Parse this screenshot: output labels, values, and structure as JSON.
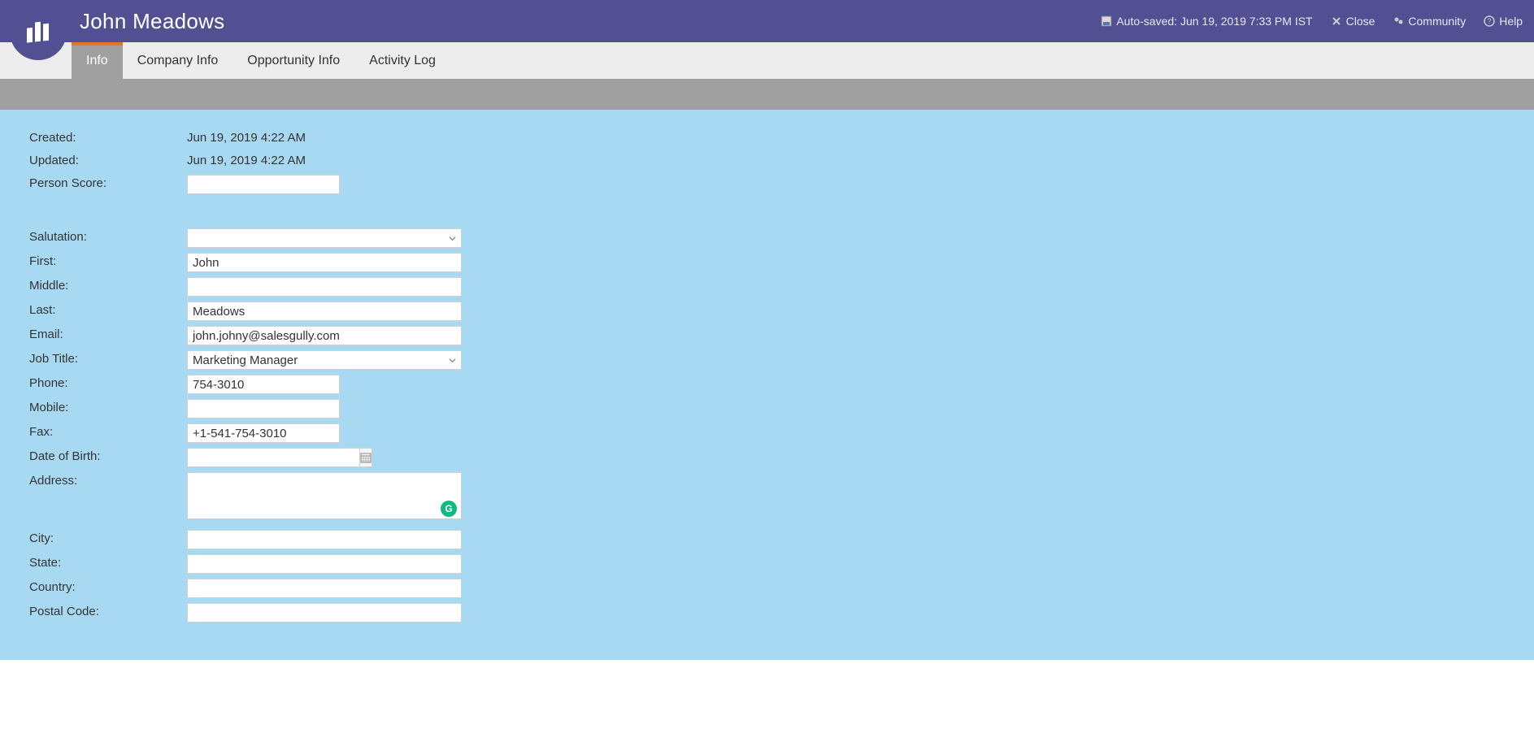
{
  "header": {
    "title": "John Meadows",
    "autosaved_label": "Auto-saved: Jun 19, 2019 7:33 PM IST",
    "close_label": "Close",
    "community_label": "Community",
    "help_label": "Help"
  },
  "tabs": {
    "info": "Info",
    "company": "Company Info",
    "opportunity": "Opportunity Info",
    "activity": "Activity Log"
  },
  "meta": {
    "created_label": "Created:",
    "created_value": "Jun 19, 2019 4:22 AM",
    "updated_label": "Updated:",
    "updated_value": "Jun 19, 2019 4:22 AM",
    "person_score_label": "Person Score:",
    "person_score_value": ""
  },
  "form": {
    "salutation_label": "Salutation:",
    "salutation_value": "",
    "first_label": "First:",
    "first_value": "John",
    "middle_label": "Middle:",
    "middle_value": "",
    "last_label": "Last:",
    "last_value": "Meadows",
    "email_label": "Email:",
    "email_value": "john.johny@salesgully.com",
    "job_title_label": "Job Title:",
    "job_title_value": "Marketing Manager",
    "phone_label": "Phone:",
    "phone_value": "754-3010",
    "mobile_label": "Mobile:",
    "mobile_value": "",
    "fax_label": "Fax:",
    "fax_value": "+1-541-754-3010",
    "dob_label": "Date of Birth:",
    "dob_value": "",
    "address_label": "Address:",
    "address_value": "",
    "city_label": "City:",
    "city_value": "",
    "state_label": "State:",
    "state_value": "",
    "country_label": "Country:",
    "country_value": "",
    "postal_label": "Postal Code:",
    "postal_value": ""
  }
}
